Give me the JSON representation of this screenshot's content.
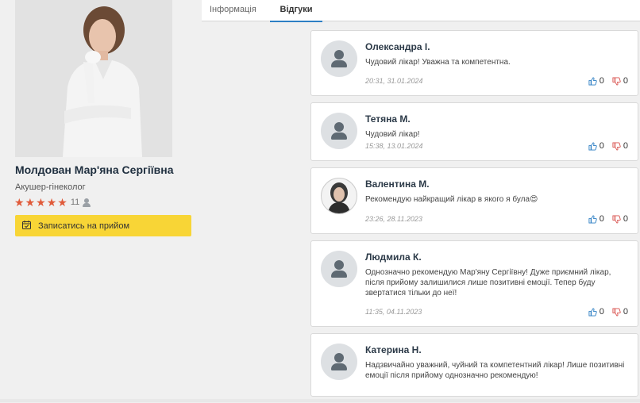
{
  "doctor": {
    "name": "Молдован Мар'яна Сергіївна",
    "specialty": "Акушер-гінеколог",
    "rating": 5,
    "reviews_count": "11",
    "book_label": "Записатись на прийом"
  },
  "tabs": [
    {
      "label": "Інформація",
      "active": false
    },
    {
      "label": "Відгуки",
      "active": true
    }
  ],
  "reviews": [
    {
      "name": "Олександра І.",
      "text": "Чудовий лікар! Уважна та компетентна.",
      "date": "20:31, 31.01.2024",
      "likes": "0",
      "dislikes": "0",
      "avatar": "placeholder"
    },
    {
      "name": "Тетяна М.",
      "text": "Чудовий лікар!",
      "date": "15:38, 13.01.2024",
      "likes": "0",
      "dislikes": "0",
      "avatar": "placeholder"
    },
    {
      "name": "Валентина М.",
      "text": "Рекомендую найкращий лікар в якого я була😍",
      "date": "23:26, 28.11.2023",
      "likes": "0",
      "dislikes": "0",
      "avatar": "photo"
    },
    {
      "name": "Людмила К.",
      "text": "Однозначно рекомендую Мар'яну Сергіївну! Дуже приємний лікар, після прийому залишилися лише позитивні емоції. Тепер буду звертатися тільки до неї!",
      "date": "11:35, 04.11.2023",
      "likes": "0",
      "dislikes": "0",
      "avatar": "placeholder"
    },
    {
      "name": "Катерина Н.",
      "text": "Надзвичайно уважний, чуйний та компетентний лікар! Лише позитивні емоції після прийому    однозначно рекомендую!",
      "date": "",
      "likes": "",
      "dislikes": "",
      "avatar": "placeholder"
    }
  ],
  "colors": {
    "accent": "#2d7fc4",
    "star": "#e05a3a",
    "button": "#f8d536",
    "like": "#2d7fc4",
    "dislike": "#d9534f"
  }
}
